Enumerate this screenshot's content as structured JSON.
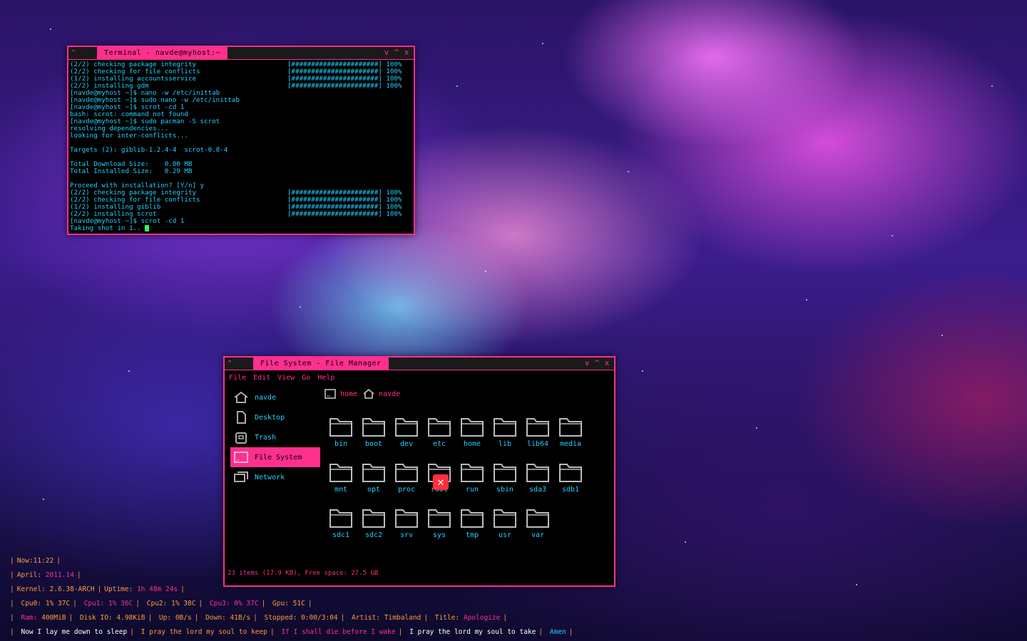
{
  "terminal": {
    "title": "Terminal - navde@myhost:~",
    "left_controls": "^",
    "controls": [
      "v",
      "^",
      "x"
    ],
    "lines": [
      {
        "text": "(2/2) checking package integrity",
        "bar": "[######################] 100%"
      },
      {
        "text": "(2/2) checking for file conflicts",
        "bar": "[######################] 100%"
      },
      {
        "text": "(1/2) installing accountsservice",
        "bar": "[######################] 100%"
      },
      {
        "text": "(2/2) installing gdm",
        "bar": "[######################] 100%"
      },
      {
        "text": "[navde@myhost ~]$ nano -w /etc/inittab",
        "bar": ""
      },
      {
        "text": "[navde@myhost ~]$ sudo nano -w /etc/inittab",
        "bar": ""
      },
      {
        "text": "[navde@myhost ~]$ scrot -cd 1",
        "bar": ""
      },
      {
        "text": "bash: scrot: command not found",
        "bar": ""
      },
      {
        "text": "[navde@myhost ~]$ sudo pacman -S scrot",
        "bar": ""
      },
      {
        "text": "resolving dependencies...",
        "bar": ""
      },
      {
        "text": "looking for inter-conflicts...",
        "bar": ""
      },
      {
        "text": "",
        "bar": ""
      },
      {
        "text": "Targets (2): giblib-1.2.4-4  scrot-0.8-4",
        "bar": ""
      },
      {
        "text": "",
        "bar": ""
      },
      {
        "text": "Total Download Size:    0.00 MB",
        "bar": ""
      },
      {
        "text": "Total Installed Size:   0.29 MB",
        "bar": ""
      },
      {
        "text": "",
        "bar": ""
      },
      {
        "text": "Proceed with installation? [Y/n] y",
        "bar": ""
      },
      {
        "text": "(2/2) checking package integrity",
        "bar": "[######################] 100%"
      },
      {
        "text": "(2/2) checking for file conflicts",
        "bar": "[######################] 100%"
      },
      {
        "text": "(1/2) installing giblib",
        "bar": "[######################] 100%"
      },
      {
        "text": "(2/2) installing scrot",
        "bar": "[######################] 100%"
      },
      {
        "text": "[navde@myhost ~]$ scrot -cd 1",
        "bar": ""
      },
      {
        "text": "Taking shot in 1.. ",
        "bar": ""
      }
    ]
  },
  "filemanager": {
    "title": "File System - File Manager",
    "left_controls": "^",
    "controls": [
      "v",
      "^",
      "x"
    ],
    "menu": [
      "File",
      "Edit",
      "View",
      "Go",
      "Help"
    ],
    "sidebar": [
      {
        "label": "navde",
        "icon": "home-icon",
        "active": false
      },
      {
        "label": "Desktop",
        "icon": "desktop-icon",
        "active": false
      },
      {
        "label": "Trash",
        "icon": "trash-icon",
        "active": false
      },
      {
        "label": "File System",
        "icon": "drive-icon",
        "active": true
      },
      {
        "label": "Network",
        "icon": "network-icon",
        "active": false
      }
    ],
    "breadcrumb": [
      "home",
      "navde"
    ],
    "folders": [
      "bin",
      "boot",
      "dev",
      "etc",
      "home",
      "lib",
      "lib64",
      "media",
      "mnt",
      "opt",
      "proc",
      "root",
      "run",
      "sbin",
      "sda3",
      "sdb1",
      "sdc1",
      "sdc2",
      "srv",
      "sys",
      "tmp",
      "usr",
      "var"
    ],
    "locked_folder": "root",
    "status": "23 items (17.9 KB), Free space: 27.5 GB"
  },
  "conky": {
    "now_label": "Now:",
    "now_value": "11:22",
    "date_label": "April:",
    "date_value": "2011.14",
    "kernel_label": "Kernel:",
    "kernel_value": "2.6.38-ARCH",
    "uptime_label": "Uptime:",
    "uptime_value": "1h 48m 24s",
    "cpus": [
      {
        "label": "Cpu0:",
        "value": "1% 37C"
      },
      {
        "label": "Cpu1:",
        "value": "1% 36C"
      },
      {
        "label": "Cpu2:",
        "value": "1% 38C"
      },
      {
        "label": "Cpu3:",
        "value": "0% 37C"
      },
      {
        "label": "Gpu:",
        "value": "51C"
      }
    ],
    "ram_label": "Ram:",
    "ram_value": "400MiB",
    "disk_label": "Disk IO:",
    "disk_value": "4.98KiB",
    "up_label": "Up:",
    "up_value": "0B/s",
    "down_label": "Down:",
    "down_value": "41B/s",
    "stopped_label": "Stopped:",
    "stopped_value": "0:00/3:04",
    "artist_label": "Artist:",
    "artist_value": "Timbaland",
    "title_label": "Title:",
    "title_value": "Apologize",
    "lyrics": [
      "Now I lay me down to sleep",
      "I pray the lord my soul to keep",
      "If I shall die before I wake",
      "I pray the lord my soul to take",
      "Amen"
    ],
    "separator": "|"
  }
}
